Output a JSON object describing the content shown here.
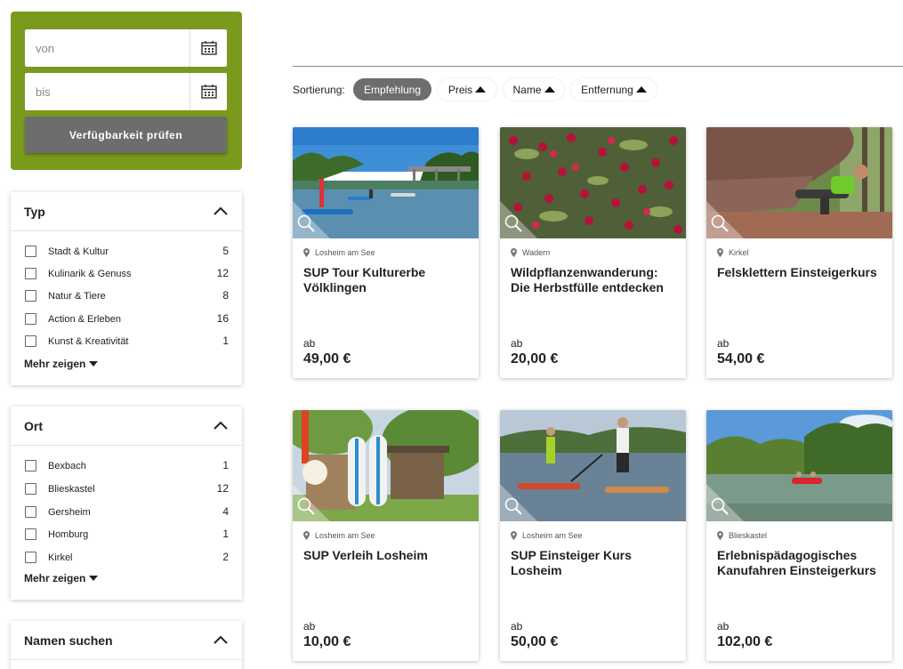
{
  "date_filter": {
    "from_placeholder": "von",
    "to_placeholder": "bis",
    "check_label": "Verfügbarkeit prüfen"
  },
  "filters": {
    "type": {
      "title": "Typ",
      "items": [
        {
          "label": "Stadt & Kultur",
          "count": "5"
        },
        {
          "label": "Kulinarik & Genuss",
          "count": "12"
        },
        {
          "label": "Natur & Tiere",
          "count": "8"
        },
        {
          "label": "Action & Erleben",
          "count": "16"
        },
        {
          "label": "Kunst & Kreativität",
          "count": "1"
        }
      ],
      "more_label": "Mehr zeigen"
    },
    "place": {
      "title": "Ort",
      "items": [
        {
          "label": "Bexbach",
          "count": "1"
        },
        {
          "label": "Blieskastel",
          "count": "12"
        },
        {
          "label": "Gersheim",
          "count": "4"
        },
        {
          "label": "Homburg",
          "count": "1"
        },
        {
          "label": "Kirkel",
          "count": "2"
        }
      ],
      "more_label": "Mehr zeigen"
    },
    "name_search": {
      "title": "Namen suchen"
    }
  },
  "sorting": {
    "label": "Sortierung:",
    "options": [
      {
        "label": "Empfehlung",
        "active": true
      },
      {
        "label": "Preis",
        "active": false
      },
      {
        "label": "Name",
        "active": false
      },
      {
        "label": "Entfernung",
        "active": false
      }
    ]
  },
  "cards": [
    {
      "location": "Losheim am See",
      "title": "SUP Tour Kulturerbe Völklingen",
      "price_prefix": "ab",
      "price": "49,00 €",
      "image": "river-sup-bridge"
    },
    {
      "location": "Wadern",
      "title": "Wildpflanzenwanderung: Die Herbstfülle entdecken",
      "price_prefix": "ab",
      "price": "20,00 €",
      "image": "red-berries"
    },
    {
      "location": "Kirkel",
      "title": "Felsklettern Einsteigerkurs",
      "price_prefix": "ab",
      "price": "54,00 €",
      "image": "rock-climber"
    },
    {
      "location": "Losheim am See",
      "title": "SUP Verleih Losheim",
      "price_prefix": "ab",
      "price": "10,00 €",
      "image": "sup-boards-rental"
    },
    {
      "location": "Losheim am See",
      "title": "SUP Einsteiger Kurs Losheim",
      "price_prefix": "ab",
      "price": "50,00 €",
      "image": "sup-lake-paddlers"
    },
    {
      "location": "Blieskastel",
      "title": "Erlebnispädagogisches Kanufahren Einsteigerkurs",
      "price_prefix": "ab",
      "price": "102,00 €",
      "image": "canoe-river"
    }
  ],
  "colors": {
    "brand_green": "#7a9a1e",
    "active_gray": "#6d6d6d"
  }
}
